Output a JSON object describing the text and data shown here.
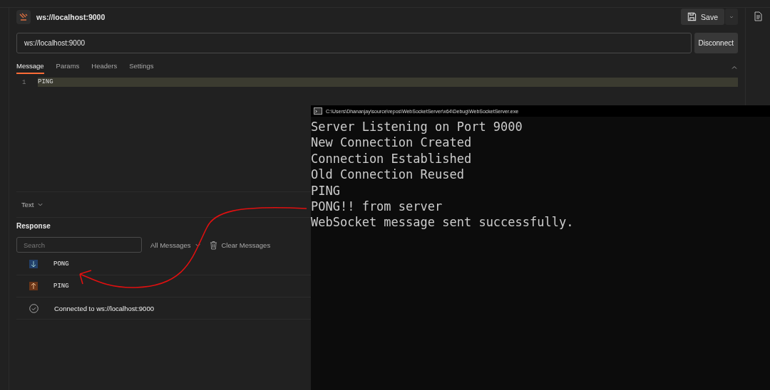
{
  "request": {
    "title": "ws://localhost:9000",
    "save": "Save",
    "url": "ws://localhost:9000",
    "connect_button": "Disconnect"
  },
  "tabs": [
    {
      "label": "Message",
      "selected": true
    },
    {
      "label": "Params",
      "selected": false
    },
    {
      "label": "Headers",
      "selected": false
    },
    {
      "label": "Settings",
      "selected": false
    }
  ],
  "editor": {
    "lines": [
      {
        "number": "1",
        "text": "PING"
      }
    ]
  },
  "format": "Text",
  "response": {
    "title": "Response",
    "search": {
      "placeholder": "Search"
    },
    "filter": "All Messages",
    "clear": "Clear Messages",
    "messages": [
      {
        "kind": "received",
        "text": "PONG"
      },
      {
        "kind": "sent",
        "text": "PING"
      },
      {
        "kind": "connected",
        "text": "Connected to ws://localhost:9000"
      }
    ]
  },
  "console": {
    "title": "C:\\Users\\Dhananjay\\source\\repos\\WebSocketServer\\x64\\Debug\\WebSocketServer.exe",
    "lines": [
      "Server Listening on Port 9000",
      "New Connection Created",
      "Connection Established",
      "Old Connection Reused",
      "PING",
      "PONG!! from server",
      "WebSocket message sent successfully."
    ]
  }
}
